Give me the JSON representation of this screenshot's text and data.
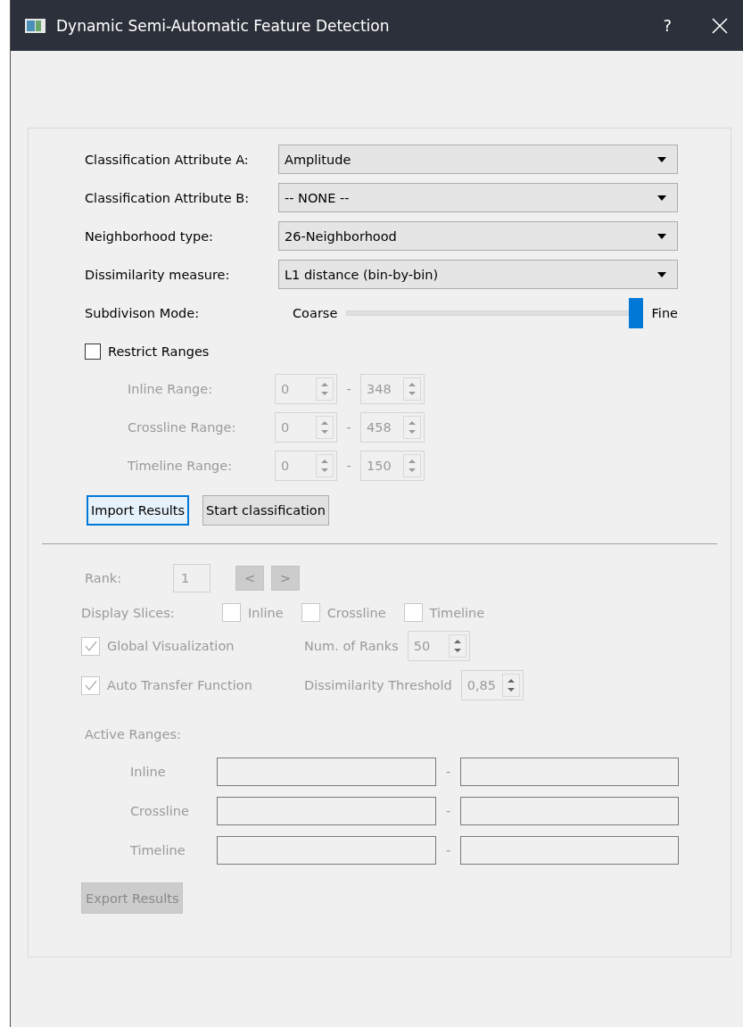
{
  "window": {
    "title": "Dynamic Semi-Automatic Feature Detection",
    "help": "?"
  },
  "settings": [
    {
      "kind": "combo",
      "label": "Classification Attribute A:",
      "value": "Amplitude"
    },
    {
      "kind": "combo",
      "label": "Classification Attribute B:",
      "value": "-- NONE --"
    },
    {
      "kind": "combo",
      "label": "Neighborhood type:",
      "value": "26-Neighborhood"
    },
    {
      "kind": "combo",
      "label": "Dissimilarity measure:",
      "value": "L1 distance (bin-by-bin)"
    },
    {
      "kind": "slider",
      "label": "Subdivison Mode:",
      "min_label": "Coarse",
      "max_label": "Fine",
      "level": 1
    }
  ],
  "restrict_ranges": {
    "label": "Restrict Ranges",
    "checked": false
  },
  "ranges": {
    "disabled": true,
    "rows": [
      {
        "label": "Inline Range:",
        "from": "0",
        "separator": "-",
        "to": "348"
      },
      {
        "label": "Crossline Range:",
        "from": "0",
        "separator": "-",
        "to": "458"
      },
      {
        "label": "Timeline Range:",
        "from": "0",
        "separator": "-",
        "to": "150"
      }
    ]
  },
  "buttons": [
    {
      "label": "Import Results",
      "focused": true
    },
    {
      "label": "Start classification",
      "focused": false
    }
  ],
  "results": {
    "disabled": true,
    "rank": {
      "label": "Rank:",
      "value": "1",
      "prev": "<",
      "next": ">"
    },
    "display_slices": {
      "label": "Display Slices:",
      "options": [
        {
          "label": "Inline",
          "checked": false
        },
        {
          "label": "Crossline",
          "checked": false
        },
        {
          "label": "Timeline",
          "checked": false
        }
      ]
    },
    "options": [
      {
        "label": "Global Visualization",
        "checked": true,
        "spin_label": "Num. of Ranks",
        "spin_value": "50"
      },
      {
        "label": "Auto Transfer Function",
        "checked": true,
        "spin_label": "Dissimilarity Threshold",
        "spin_value": "0,85"
      }
    ],
    "active_ranges": {
      "label": "Active Ranges:",
      "rows": [
        {
          "label": "Inline",
          "separator": "-"
        },
        {
          "label": "Crossline",
          "separator": "-"
        },
        {
          "label": "Timeline",
          "separator": "-"
        }
      ]
    },
    "export": "Export Results"
  }
}
